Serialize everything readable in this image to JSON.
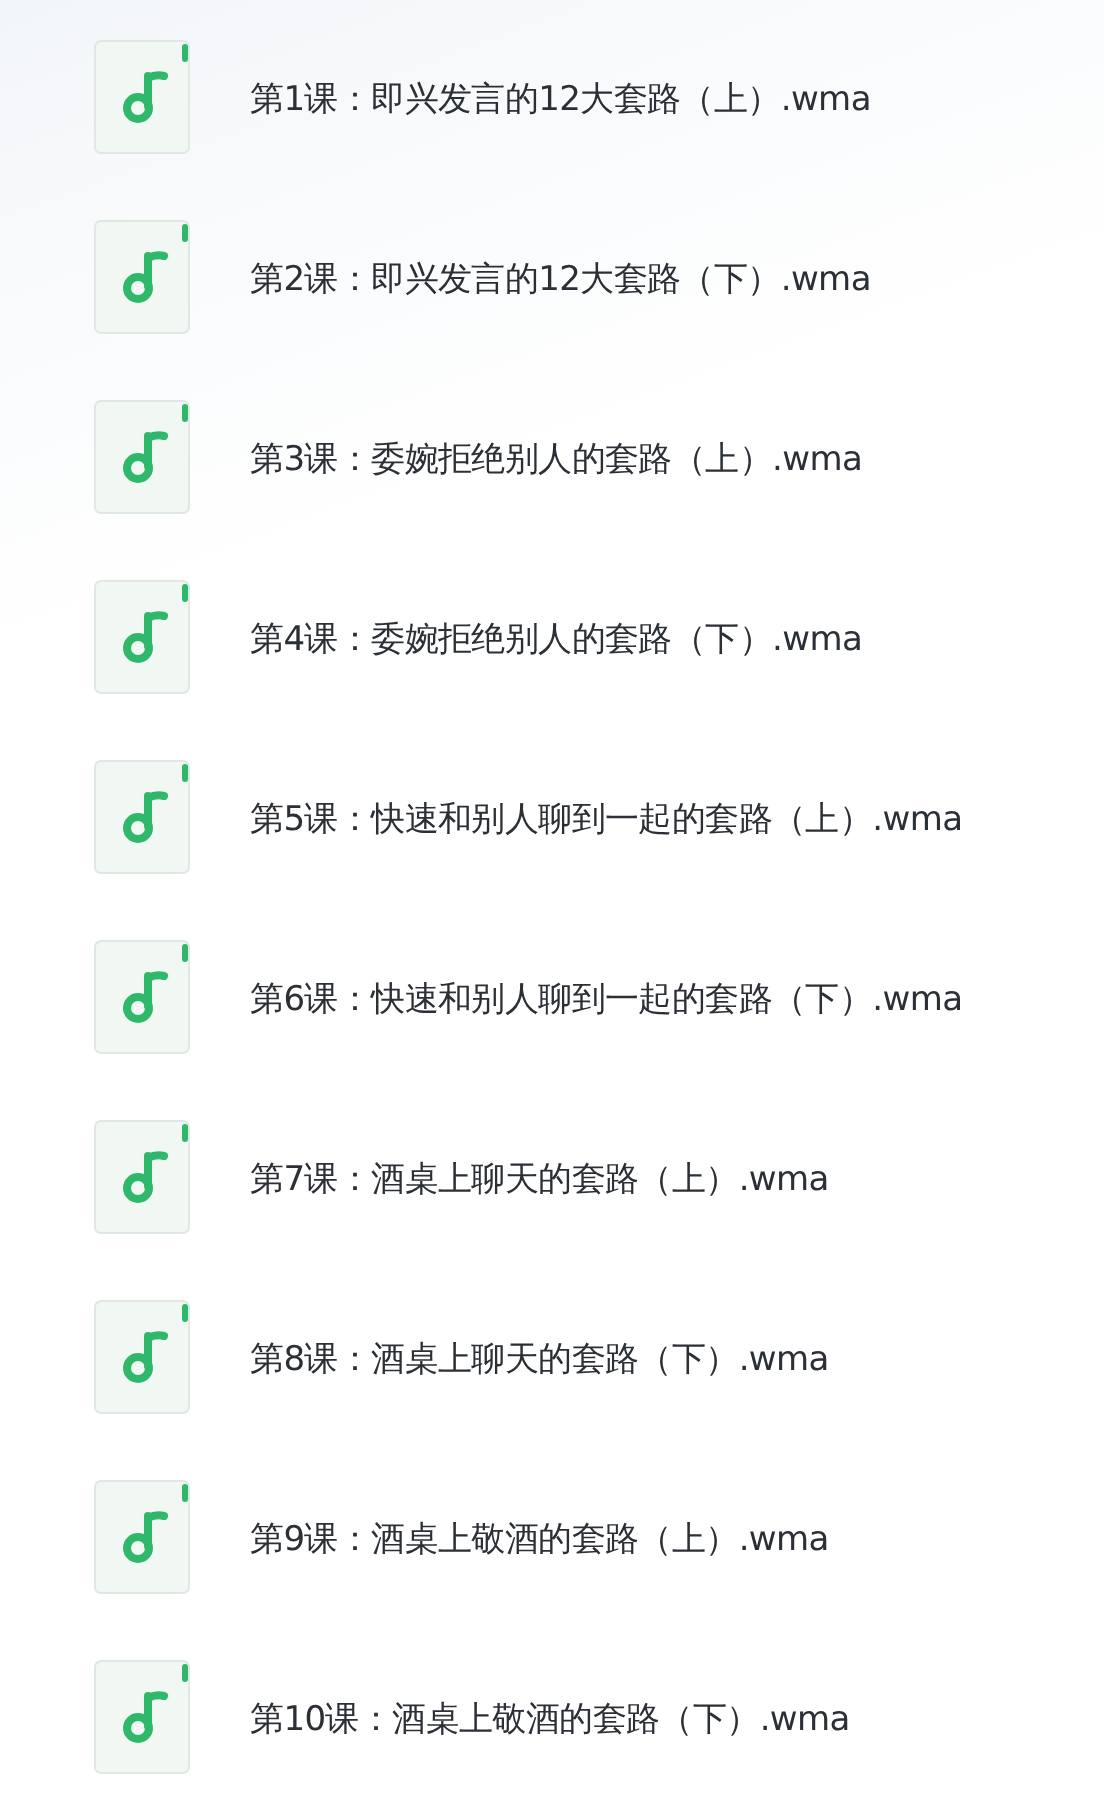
{
  "files": [
    {
      "name": "第1课：即兴发言的12大套路（上）.wma"
    },
    {
      "name": "第2课：即兴发言的12大套路（下）.wma"
    },
    {
      "name": "第3课：委婉拒绝别人的套路（上）.wma"
    },
    {
      "name": "第4课：委婉拒绝别人的套路（下）.wma"
    },
    {
      "name": "第5课：快速和别人聊到一起的套路（上）.wma"
    },
    {
      "name": "第6课：快速和别人聊到一起的套路（下）.wma"
    },
    {
      "name": "第7课：酒桌上聊天的套路（上）.wma"
    },
    {
      "name": "第8课：酒桌上聊天的套路（下）.wma"
    },
    {
      "name": "第9课：酒桌上敬酒的套路（上）.wma"
    },
    {
      "name": "第10课：酒桌上敬酒的套路（下）.wma"
    }
  ]
}
